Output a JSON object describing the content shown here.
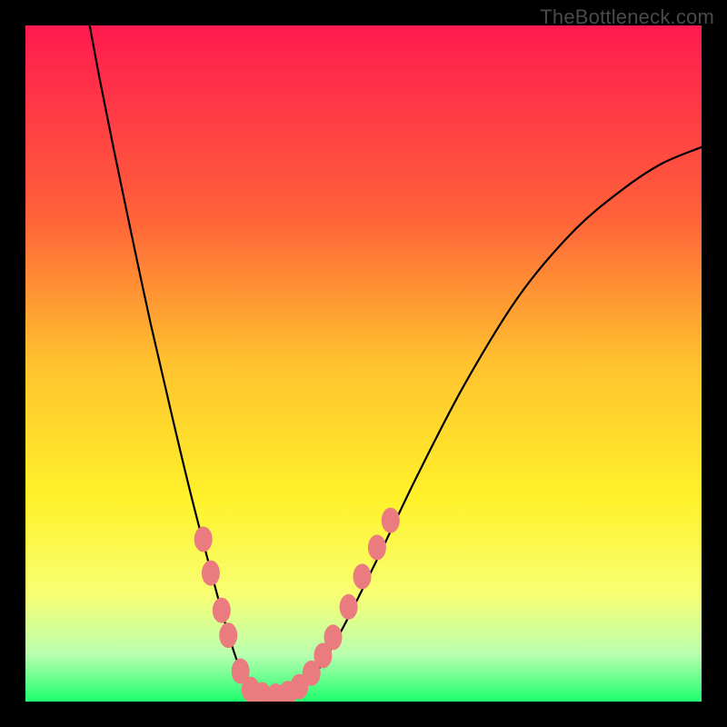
{
  "watermark": "TheBottleneck.com",
  "chart_data": {
    "type": "line",
    "title": "",
    "xlabel": "",
    "ylabel": "",
    "xlim": [
      0,
      1
    ],
    "ylim": [
      0,
      1
    ],
    "background_gradient_stops": [
      {
        "offset": 0.0,
        "color": "#ff1a4f"
      },
      {
        "offset": 0.28,
        "color": "#ff613a"
      },
      {
        "offset": 0.5,
        "color": "#ffc22e"
      },
      {
        "offset": 0.7,
        "color": "#fff22a"
      },
      {
        "offset": 0.84,
        "color": "#f8ff72"
      },
      {
        "offset": 0.93,
        "color": "#baffb0"
      },
      {
        "offset": 1.0,
        "color": "#1eff6f"
      }
    ],
    "series": [
      {
        "name": "curve",
        "values": [
          {
            "x": 0.095,
            "y": 1.0
          },
          {
            "x": 0.11,
            "y": 0.92
          },
          {
            "x": 0.13,
            "y": 0.82
          },
          {
            "x": 0.155,
            "y": 0.7
          },
          {
            "x": 0.185,
            "y": 0.56
          },
          {
            "x": 0.215,
            "y": 0.43
          },
          {
            "x": 0.245,
            "y": 0.305
          },
          {
            "x": 0.275,
            "y": 0.19
          },
          {
            "x": 0.3,
            "y": 0.1
          },
          {
            "x": 0.32,
            "y": 0.042
          },
          {
            "x": 0.335,
            "y": 0.018
          },
          {
            "x": 0.35,
            "y": 0.008
          },
          {
            "x": 0.37,
            "y": 0.004
          },
          {
            "x": 0.39,
            "y": 0.008
          },
          {
            "x": 0.41,
            "y": 0.02
          },
          {
            "x": 0.435,
            "y": 0.05
          },
          {
            "x": 0.47,
            "y": 0.11
          },
          {
            "x": 0.52,
            "y": 0.21
          },
          {
            "x": 0.58,
            "y": 0.335
          },
          {
            "x": 0.65,
            "y": 0.47
          },
          {
            "x": 0.73,
            "y": 0.6
          },
          {
            "x": 0.81,
            "y": 0.695
          },
          {
            "x": 0.88,
            "y": 0.755
          },
          {
            "x": 0.94,
            "y": 0.795
          },
          {
            "x": 1.0,
            "y": 0.82
          }
        ]
      }
    ],
    "markers": {
      "color": "#ea7b7e",
      "radius_w": 10,
      "radius_h": 14,
      "points": [
        {
          "x": 0.263,
          "y": 0.24
        },
        {
          "x": 0.274,
          "y": 0.19
        },
        {
          "x": 0.29,
          "y": 0.135
        },
        {
          "x": 0.3,
          "y": 0.098
        },
        {
          "x": 0.318,
          "y": 0.045
        },
        {
          "x": 0.333,
          "y": 0.018
        },
        {
          "x": 0.35,
          "y": 0.01
        },
        {
          "x": 0.37,
          "y": 0.008
        },
        {
          "x": 0.388,
          "y": 0.012
        },
        {
          "x": 0.405,
          "y": 0.022
        },
        {
          "x": 0.423,
          "y": 0.042
        },
        {
          "x": 0.44,
          "y": 0.068
        },
        {
          "x": 0.455,
          "y": 0.095
        },
        {
          "x": 0.478,
          "y": 0.14
        },
        {
          "x": 0.498,
          "y": 0.185
        },
        {
          "x": 0.52,
          "y": 0.228
        },
        {
          "x": 0.54,
          "y": 0.268
        }
      ]
    }
  }
}
